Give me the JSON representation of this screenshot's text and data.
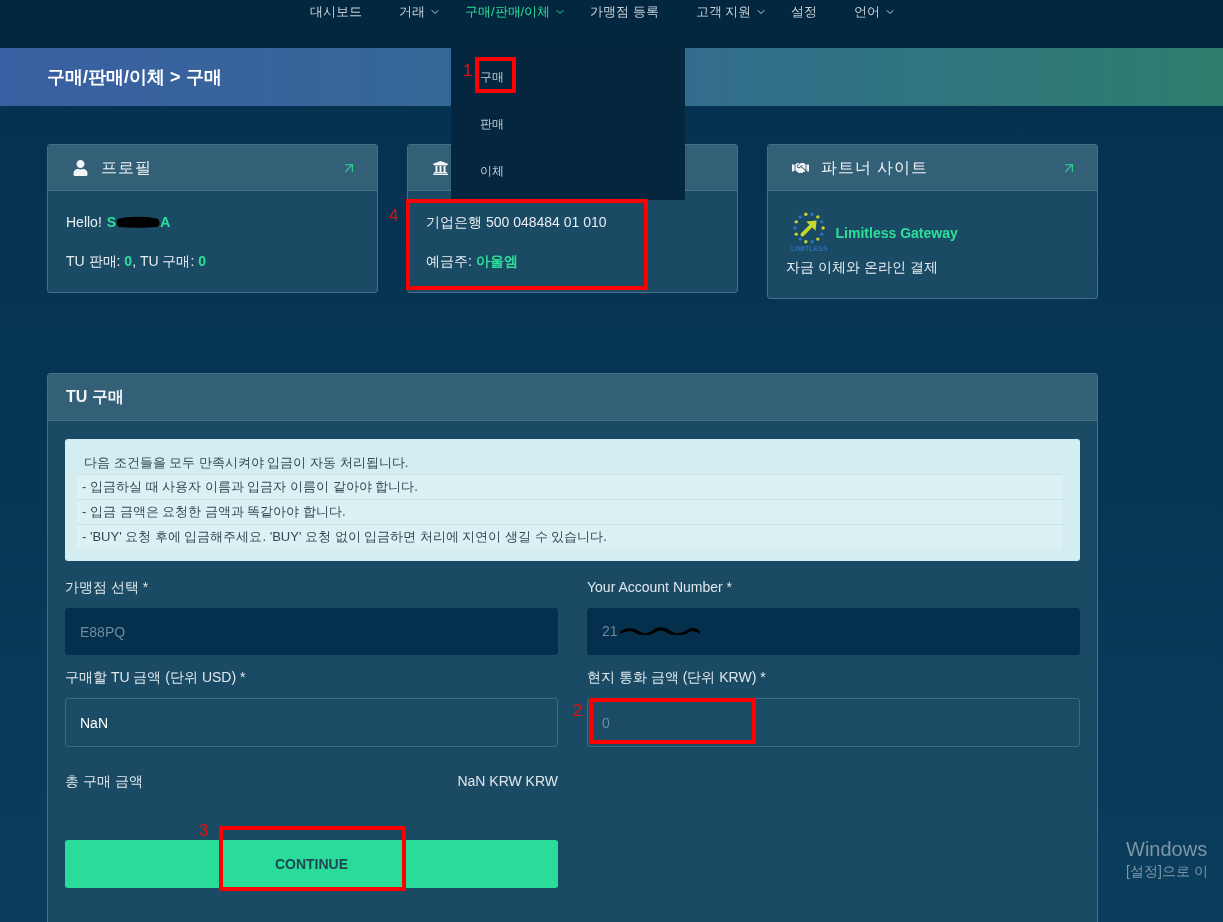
{
  "nav": {
    "items": [
      {
        "label": "대시보드",
        "dropdown": false,
        "selected": false
      },
      {
        "label": "거래",
        "dropdown": true,
        "selected": false
      },
      {
        "label": "구매/판매/이체",
        "dropdown": true,
        "selected": true
      },
      {
        "label": "가맹점 등록",
        "dropdown": false,
        "selected": false
      },
      {
        "label": "고객 지원",
        "dropdown": true,
        "selected": false
      },
      {
        "label": "설정",
        "dropdown": false,
        "selected": false
      },
      {
        "label": "언어",
        "dropdown": true,
        "selected": false
      }
    ]
  },
  "dropdown": {
    "items": [
      {
        "label": "구매"
      },
      {
        "label": "판매"
      },
      {
        "label": "이체"
      }
    ]
  },
  "page_header": {
    "breadcrumb": "구매/판매/이체 > 구매"
  },
  "cards": [
    {
      "kind": "profile",
      "title": "프로필",
      "link": true,
      "greeting": "Hello!",
      "name_start": "S",
      "name_end": "A",
      "stats": "TU 판매: **0**, TU 구매: **0**"
    },
    {
      "kind": "bank",
      "link": false,
      "account": "기업은행 500 048484 01 010",
      "holder": "예금주: **아울엠**"
    },
    {
      "kind": "partner",
      "title": "파트너 사이트",
      "link": true,
      "logo_name": "Limitless Gateway",
      "logo_caption": "LIMITLESS",
      "description": "자금 이체와 온라인 결제"
    }
  ],
  "purchase": {
    "title": "TU 구매",
    "notice": {
      "intro": "다음 조건들을 모두 만족시켜야 입금이 자동 처리됩니다.",
      "rules": [
        "- 입금하실 때 사용자 이름과 입금자 이름이 같아야 합니다.",
        "- 입금 금액은 요청한 금액과 똑같아야 합니다.",
        "- 'BUY' 요청 후에 입금해주세요. 'BUY' 요청 없이 입금하면 처리에 지연이 생길 수 있습니다."
      ]
    },
    "fields": [
      {
        "label": "가맹점 선택 *",
        "value": "E88PQ",
        "disabled": true
      },
      {
        "label": "Your Account Number *",
        "value": "21",
        "redacted": true,
        "disabled": true
      },
      {
        "label": "구매할 TU 금액 (단위 USD) *",
        "value": "NaN",
        "disabled": false
      },
      {
        "label": "현지 통화 금액 (단위 KRW) *",
        "placeholder": "0",
        "disabled": false
      }
    ],
    "total": {
      "label": "총 구매 금액",
      "value": "NaN KRW KRW"
    },
    "button": "CONTINUE"
  },
  "annotations": [
    {
      "number": "1"
    },
    {
      "number": "2"
    },
    {
      "number": "3"
    },
    {
      "number": "4"
    }
  ],
  "system_overlay": {
    "title": "Windows",
    "subtitle": "[설정]으로 이"
  }
}
